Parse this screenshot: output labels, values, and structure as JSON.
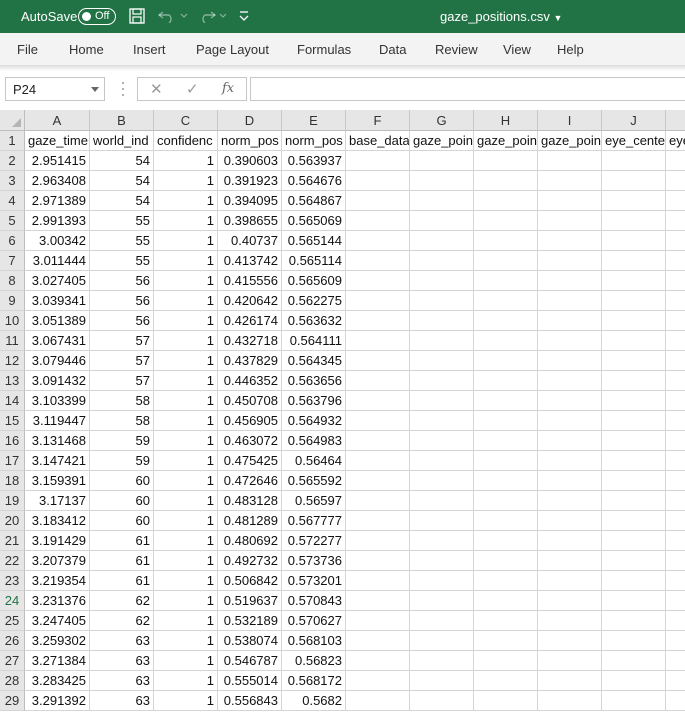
{
  "titlebar": {
    "autosave_label": "AutoSave",
    "autosave_state": "Off",
    "doc_title": "gaze_positions.csv",
    "bg_color": "#217346"
  },
  "menu": {
    "tabs": [
      "File",
      "Home",
      "Insert",
      "Page Layout",
      "Formulas",
      "Data",
      "Review",
      "View",
      "Help"
    ]
  },
  "formula_bar": {
    "name_box": "P24",
    "fx_label": "fx",
    "value": ""
  },
  "grid": {
    "columns": [
      "A",
      "B",
      "C",
      "D",
      "E",
      "F",
      "G",
      "H",
      "I",
      "J"
    ],
    "selected_row": "24",
    "rows": [
      {
        "n": "1",
        "cells": [
          "gaze_time",
          "world_ind",
          "confidenc",
          "norm_pos",
          "norm_pos",
          "base_data",
          "gaze_poin",
          "gaze_poin",
          "gaze_poin",
          "eye_cente",
          "eye"
        ]
      },
      {
        "n": "2",
        "cells": [
          "2.951415",
          "54",
          "1",
          "0.390603",
          "0.563937"
        ]
      },
      {
        "n": "3",
        "cells": [
          "2.963408",
          "54",
          "1",
          "0.391923",
          "0.564676"
        ]
      },
      {
        "n": "4",
        "cells": [
          "2.971389",
          "54",
          "1",
          "0.394095",
          "0.564867"
        ]
      },
      {
        "n": "5",
        "cells": [
          "2.991393",
          "55",
          "1",
          "0.398655",
          "0.565069"
        ]
      },
      {
        "n": "6",
        "cells": [
          "3.00342",
          "55",
          "1",
          "0.40737",
          "0.565144"
        ]
      },
      {
        "n": "7",
        "cells": [
          "3.011444",
          "55",
          "1",
          "0.413742",
          "0.565114"
        ]
      },
      {
        "n": "8",
        "cells": [
          "3.027405",
          "56",
          "1",
          "0.415556",
          "0.565609"
        ]
      },
      {
        "n": "9",
        "cells": [
          "3.039341",
          "56",
          "1",
          "0.420642",
          "0.562275"
        ]
      },
      {
        "n": "10",
        "cells": [
          "3.051389",
          "56",
          "1",
          "0.426174",
          "0.563632"
        ]
      },
      {
        "n": "11",
        "cells": [
          "3.067431",
          "57",
          "1",
          "0.432718",
          "0.564111"
        ]
      },
      {
        "n": "12",
        "cells": [
          "3.079446",
          "57",
          "1",
          "0.437829",
          "0.564345"
        ]
      },
      {
        "n": "13",
        "cells": [
          "3.091432",
          "57",
          "1",
          "0.446352",
          "0.563656"
        ]
      },
      {
        "n": "14",
        "cells": [
          "3.103399",
          "58",
          "1",
          "0.450708",
          "0.563796"
        ]
      },
      {
        "n": "15",
        "cells": [
          "3.119447",
          "58",
          "1",
          "0.456905",
          "0.564932"
        ]
      },
      {
        "n": "16",
        "cells": [
          "3.131468",
          "59",
          "1",
          "0.463072",
          "0.564983"
        ]
      },
      {
        "n": "17",
        "cells": [
          "3.147421",
          "59",
          "1",
          "0.475425",
          "0.56464"
        ]
      },
      {
        "n": "18",
        "cells": [
          "3.159391",
          "60",
          "1",
          "0.472646",
          "0.565592"
        ]
      },
      {
        "n": "19",
        "cells": [
          "3.17137",
          "60",
          "1",
          "0.483128",
          "0.56597"
        ]
      },
      {
        "n": "20",
        "cells": [
          "3.183412",
          "60",
          "1",
          "0.481289",
          "0.567777"
        ]
      },
      {
        "n": "21",
        "cells": [
          "3.191429",
          "61",
          "1",
          "0.480692",
          "0.572277"
        ]
      },
      {
        "n": "22",
        "cells": [
          "3.207379",
          "61",
          "1",
          "0.492732",
          "0.573736"
        ]
      },
      {
        "n": "23",
        "cells": [
          "3.219354",
          "61",
          "1",
          "0.506842",
          "0.573201"
        ]
      },
      {
        "n": "24",
        "cells": [
          "3.231376",
          "62",
          "1",
          "0.519637",
          "0.570843"
        ]
      },
      {
        "n": "25",
        "cells": [
          "3.247405",
          "62",
          "1",
          "0.532189",
          "0.570627"
        ]
      },
      {
        "n": "26",
        "cells": [
          "3.259302",
          "63",
          "1",
          "0.538074",
          "0.568103"
        ]
      },
      {
        "n": "27",
        "cells": [
          "3.271384",
          "63",
          "1",
          "0.546787",
          "0.56823"
        ]
      },
      {
        "n": "28",
        "cells": [
          "3.283425",
          "63",
          "1",
          "0.555014",
          "0.568172"
        ]
      },
      {
        "n": "29",
        "cells": [
          "3.291392",
          "63",
          "1",
          "0.556843",
          "0.5682"
        ]
      }
    ]
  }
}
